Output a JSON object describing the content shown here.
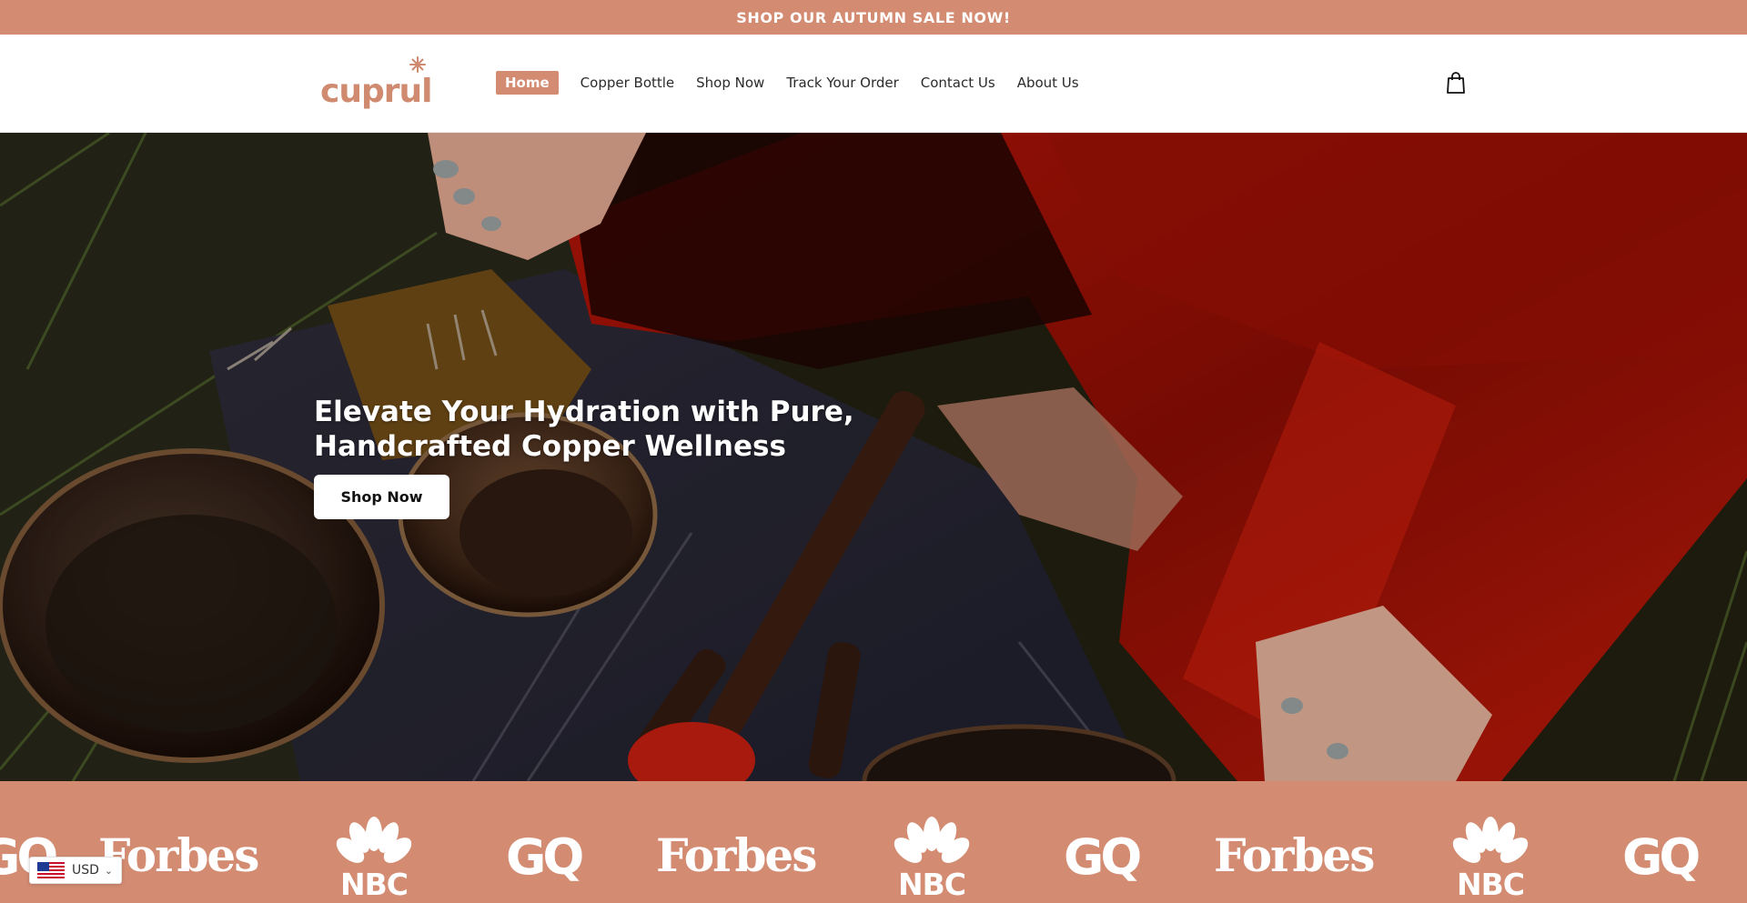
{
  "announcement": {
    "text": "SHOP OUR AUTUMN SALE NOW!"
  },
  "header": {
    "logo_text": "cuprul",
    "nav": [
      {
        "label": "Home",
        "active": true
      },
      {
        "label": "Copper Bottle",
        "active": false
      },
      {
        "label": "Shop Now",
        "active": false
      },
      {
        "label": "Track Your Order",
        "active": false
      },
      {
        "label": "Contact Us",
        "active": false
      },
      {
        "label": "About Us",
        "active": false
      }
    ],
    "cart_icon": "shopping-bag-icon"
  },
  "hero": {
    "title_line1": "Elevate Your Hydration with Pure,",
    "title_line2": "Handcrafted Copper Wellness",
    "button_label": "Shop Now"
  },
  "press": {
    "logos": [
      "GQ",
      "Forbes",
      "NBC",
      "GQ",
      "Forbes",
      "NBC",
      "GQ",
      "Forbes",
      "NBC",
      "GQ"
    ]
  },
  "currency": {
    "code": "USD",
    "flag_icon": "us-flag-icon"
  },
  "colors": {
    "brand": "#d38b72",
    "white": "#ffffff",
    "text_dark": "#2b2b2b"
  }
}
